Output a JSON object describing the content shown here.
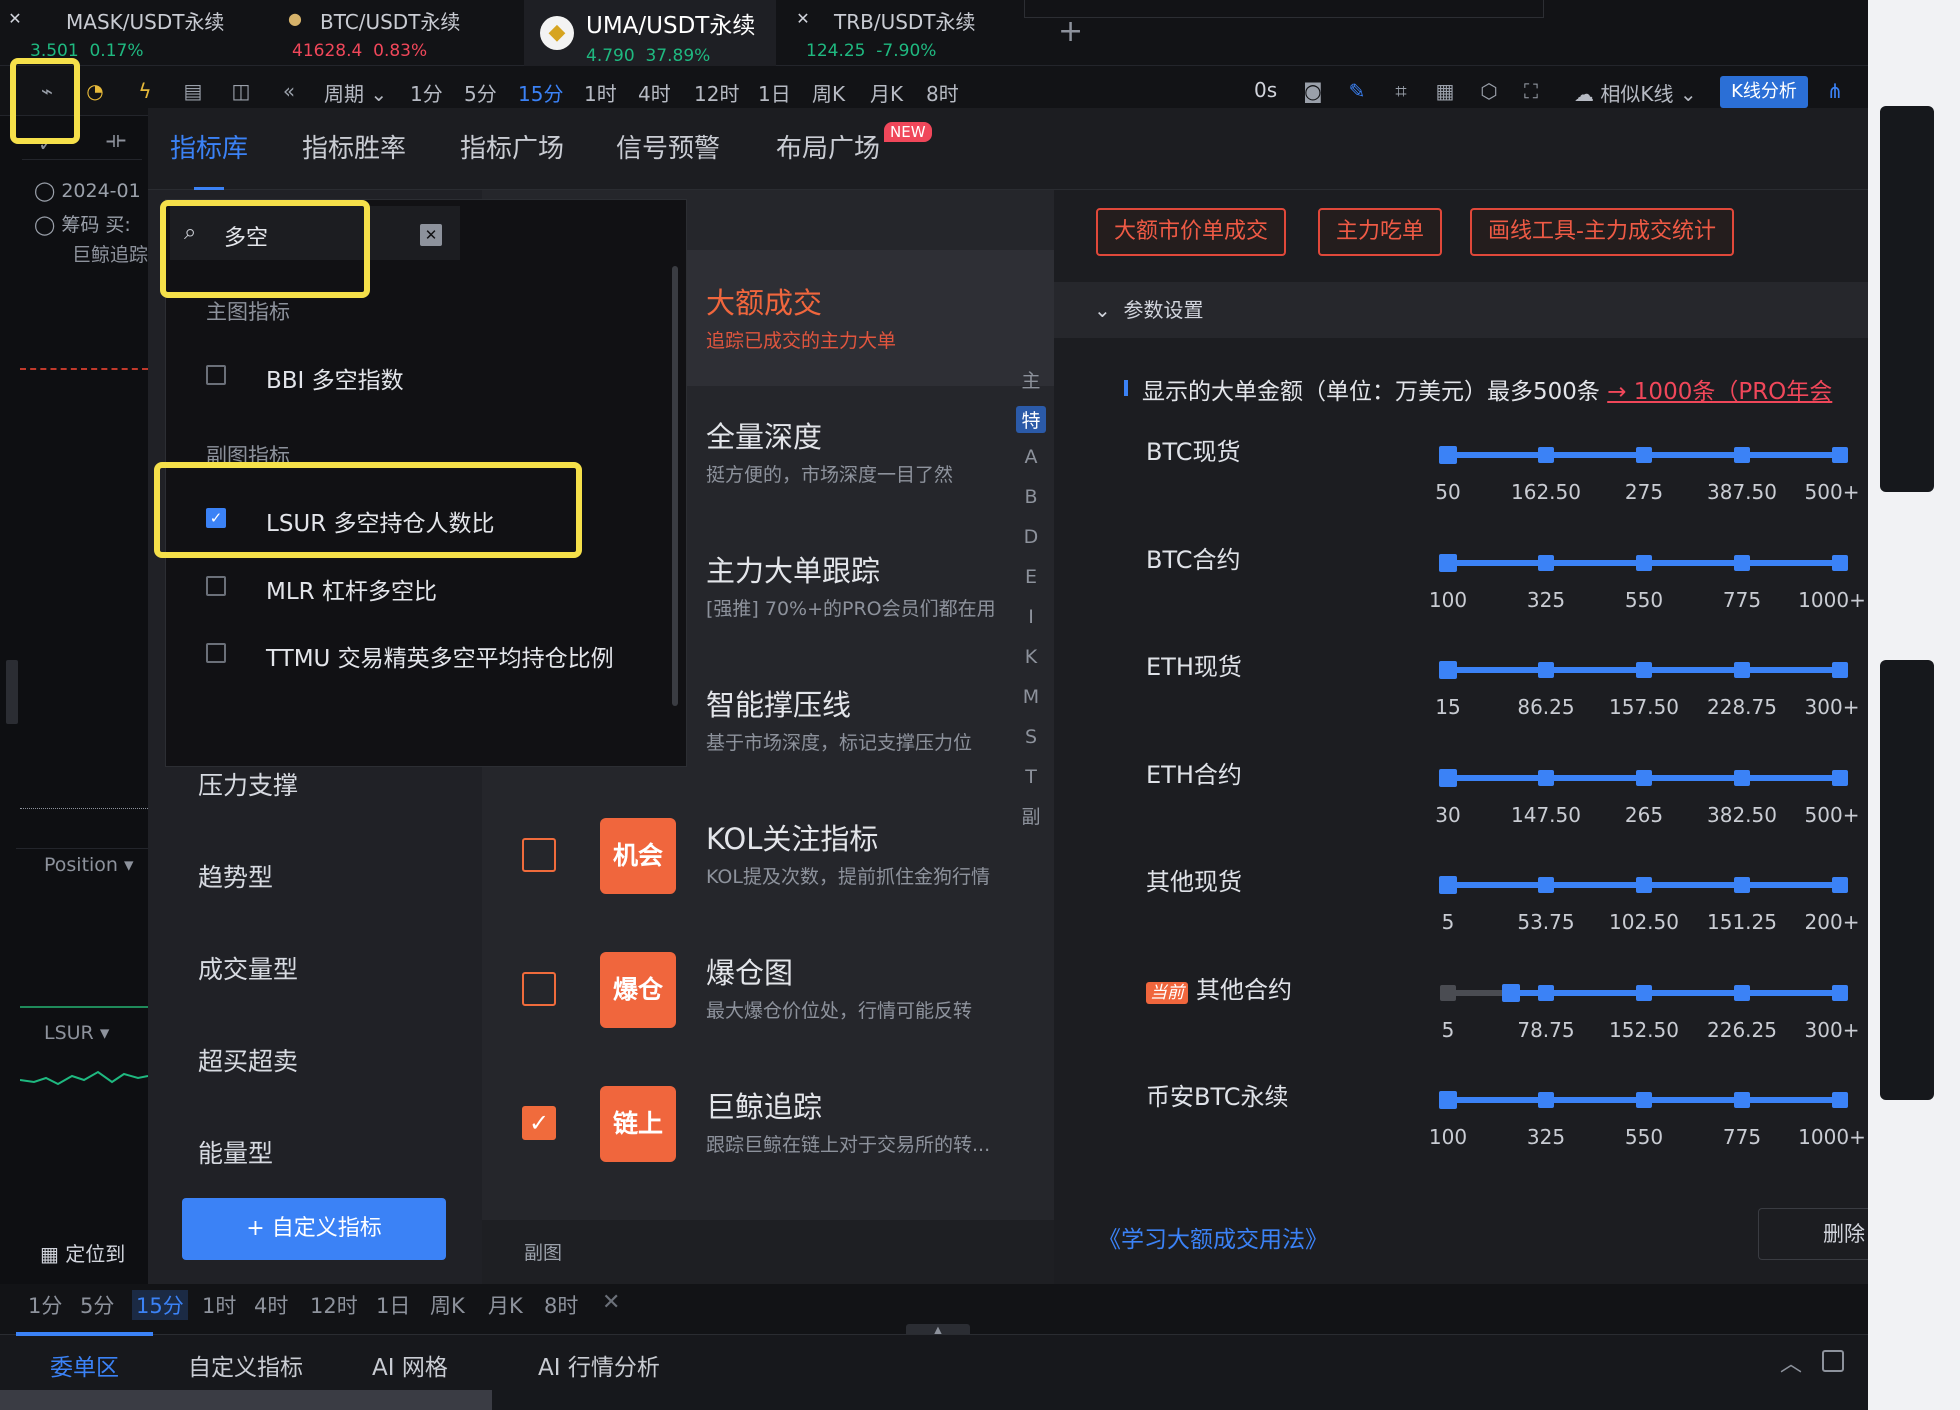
{
  "tickers": [
    {
      "symbol": "MASK/USDT永续",
      "price": "3.501",
      "change": "0.17%",
      "dir": "up"
    },
    {
      "symbol": "BTC/USDT永续",
      "price": "41628.4",
      "change": "0.83%",
      "dir": "down"
    },
    {
      "symbol": "UMA/USDT永续",
      "price": "4.790",
      "change": "37.89%",
      "dir": "up"
    },
    {
      "symbol": "TRB/USDT永续",
      "price": "124.25",
      "change": "-7.90%",
      "dir": "up"
    }
  ],
  "toolbar": {
    "period_label": "周期",
    "timeframes": [
      "1分",
      "5分",
      "15分",
      "1时",
      "4时",
      "12时",
      "1日",
      "周K",
      "月K",
      "8时"
    ],
    "selected_timeframe": "15分",
    "countdown": "0s",
    "similar_label": "相似K线",
    "kline_analysis": "K线分析"
  },
  "left_panel": {
    "date": "2024-01",
    "chips": "筹码 买:",
    "whale": "巨鲸追踪",
    "position_label": "Position",
    "lsur_label": "LSUR",
    "locate_label": "定位到"
  },
  "modal": {
    "tabs": [
      "指标库",
      "指标胜率",
      "指标广场",
      "信号预警",
      "布局广场"
    ],
    "new_badge": "NEW",
    "categories": [
      "压力支撑",
      "趋势型",
      "成交量型",
      "超买超卖",
      "能量型"
    ],
    "custom_button": "+ 自定义指标",
    "main_section": "主图",
    "sub_section": "副图",
    "items": [
      {
        "title": "大额成交",
        "desc": "追踪已成交的主力大单"
      },
      {
        "title": "全量深度",
        "desc": "挺方便的，市场深度一目了然"
      },
      {
        "title": "主力大单跟踪",
        "desc": "[强推] 70%+的PRO会员们都在用"
      },
      {
        "title": "智能撑压线",
        "desc": "基于市场深度，标记支撑压力位"
      },
      {
        "title": "KOL关注指标",
        "desc": "KOL提及次数，提前抓住金狗行情",
        "badge": "机会",
        "checked": false
      },
      {
        "title": "爆仓图",
        "desc": "最大爆仓价位处，行情可能反转",
        "badge": "爆仓",
        "checked": false
      },
      {
        "title": "巨鲸追踪",
        "desc": "跟踪巨鲸在链上对于交易所的转...",
        "badge": "链上",
        "checked": true
      }
    ],
    "alpha_index": [
      "主",
      "特",
      "A",
      "B",
      "D",
      "E",
      "I",
      "K",
      "M",
      "S",
      "T",
      "副"
    ],
    "alpha_selected": "特",
    "action_buttons": [
      "大额市价单成交",
      "主力吃单",
      "画线工具-主力成交统计"
    ],
    "param_header": "参数设置",
    "display_title": "显示的大单金额（单位：万美元）最多500条",
    "pro_link": "→ 1000条（PRO年会",
    "sliders": [
      {
        "label": "BTC现货",
        "ticks": [
          "50",
          "162.50",
          "275",
          "387.50",
          "500+"
        ],
        "value_fraction": 0
      },
      {
        "label": "BTC合约",
        "ticks": [
          "100",
          "325",
          "550",
          "775",
          "1000+"
        ],
        "value_fraction": 0
      },
      {
        "label": "ETH现货",
        "ticks": [
          "15",
          "86.25",
          "157.50",
          "228.75",
          "300+"
        ],
        "value_fraction": 0
      },
      {
        "label": "ETH合约",
        "ticks": [
          "30",
          "147.50",
          "265",
          "382.50",
          "500+"
        ],
        "value_fraction": 0
      },
      {
        "label": "其他现货",
        "ticks": [
          "5",
          "53.75",
          "102.50",
          "151.25",
          "200+"
        ],
        "value_fraction": 0
      },
      {
        "label": "其他合约",
        "current_badge": "当前",
        "ticks": [
          "5",
          "78.75",
          "152.50",
          "226.25",
          "300+"
        ],
        "value_fraction": 0.16
      },
      {
        "label": "币安BTC永续",
        "ticks": [
          "100",
          "325",
          "550",
          "775",
          "1000+"
        ],
        "value_fraction": 0
      }
    ],
    "learn_link": "《学习大额成交用法》",
    "delete_button": "删除"
  },
  "search_popup": {
    "query": "多空",
    "group_main": "主图指标",
    "group_sub": "副图指标",
    "results": [
      {
        "label": "BBI 多空指数",
        "checked": false
      },
      {
        "label": "LSUR 多空持仓人数比",
        "checked": true
      },
      {
        "label": "MLR 杠杆多空比",
        "checked": false
      },
      {
        "label": "TTMU 交易精英多空平均持仓比例",
        "checked": false
      }
    ]
  },
  "bottom_timeframes": [
    "1分",
    "5分",
    "15分",
    "1时",
    "4时",
    "12时",
    "1日",
    "周K",
    "月K",
    "8时"
  ],
  "bottom_tabs": [
    "委单区",
    "自定义指标",
    "AI 网格",
    "AI 行情分析"
  ],
  "colors": {
    "accent": "#3b82f6",
    "orange": "#f0663d",
    "highlight": "#f5e04a",
    "up": "#1fb980",
    "down": "#f0475a"
  }
}
